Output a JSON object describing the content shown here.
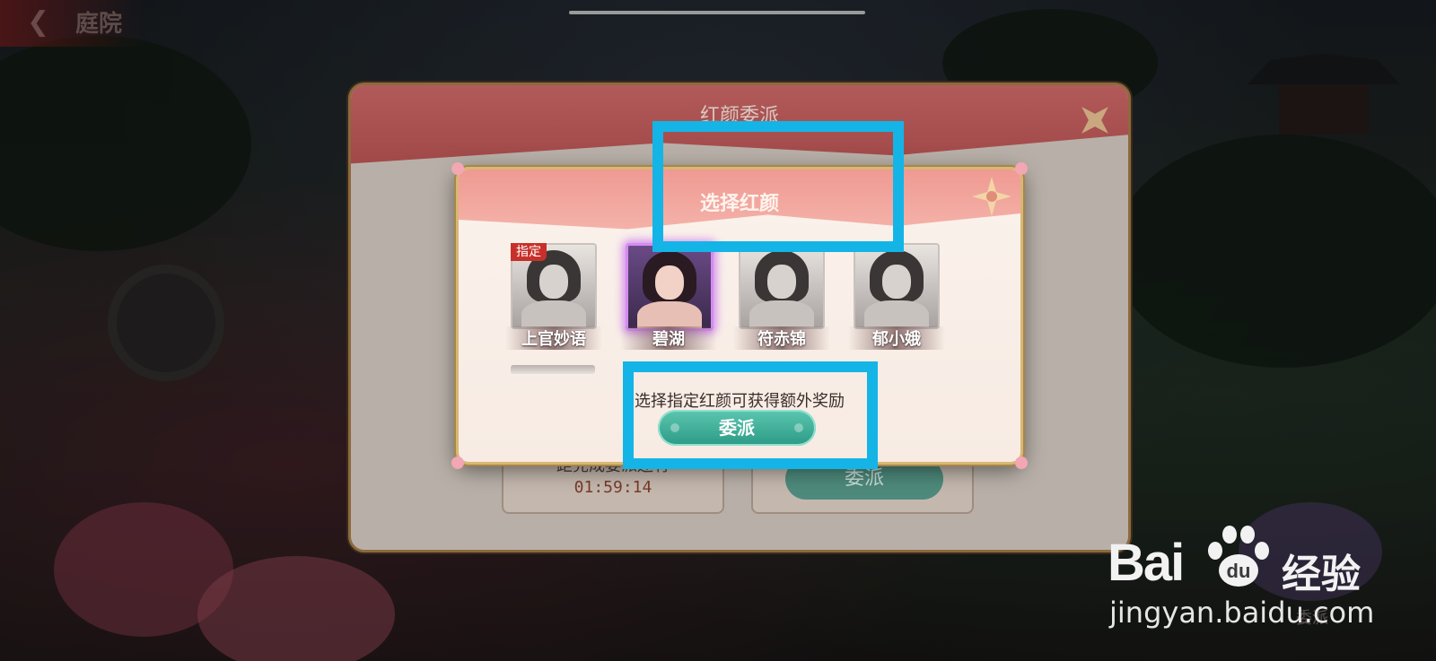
{
  "screen": {
    "title": "庭院"
  },
  "outer_dialog": {
    "title": "红颜委派",
    "remaining_label": "距完成委派还有",
    "remaining_time": "01:59:14",
    "assign_label": "委派",
    "side_label": "委派"
  },
  "select_dialog": {
    "title": "选择红颜",
    "characters": [
      {
        "name": "上官妙语",
        "tag": "指定",
        "selected": false
      },
      {
        "name": "碧湖",
        "tag": "",
        "selected": true
      },
      {
        "name": "符赤锦",
        "tag": "",
        "selected": false
      },
      {
        "name": "郁小娥",
        "tag": "",
        "selected": false
      }
    ],
    "hint": "选择指定红颜可获得额外奖励",
    "assign_button": "委派"
  },
  "watermark": {
    "brand": "Bai",
    "brand_suffix": "经验",
    "url": "jingyan.baidu.com"
  },
  "colors": {
    "highlight": "#14b4e6",
    "header_pink": "#ef9a92",
    "assign_green": "#2c9a86",
    "selected_glow": "#d48cf0",
    "tag_red": "#c7302a"
  }
}
